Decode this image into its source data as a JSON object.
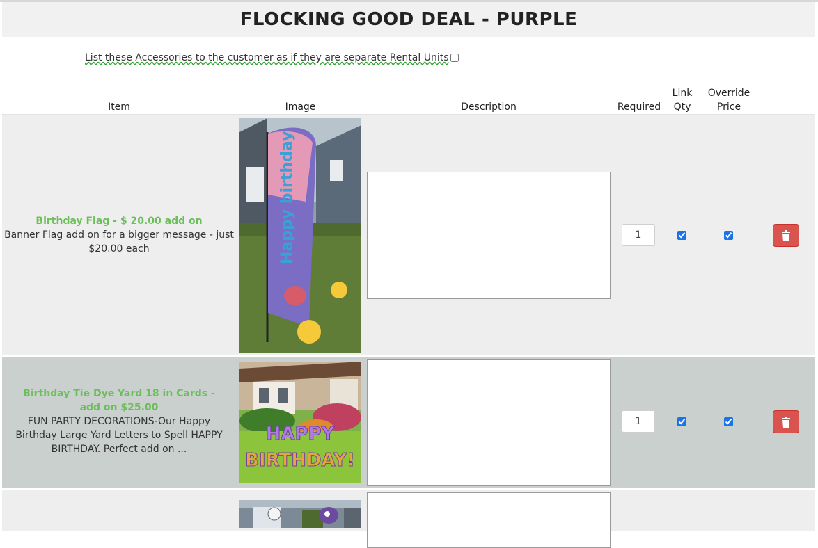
{
  "page_title": "FLOCKING GOOD DEAL - PURPLE",
  "list_option_label": "List these Accessories to the customer as if they are separate Rental Units",
  "list_option_checked": false,
  "table": {
    "headers": {
      "item": "Item",
      "image": "Image",
      "description": "Description",
      "required": "Required",
      "link_qty_line1": "Link",
      "link_qty_line2": "Qty",
      "override_line1": "Override",
      "override_line2": "Price"
    },
    "rows": [
      {
        "name": "Birthday Flag - $ 20.00 add on",
        "summary": "Banner Flag add on for a bigger message - just $20.00 each",
        "image_icon": "birthday-flag-photo",
        "image_text": "Happy birthday",
        "description_value": "",
        "required_qty": "1",
        "link_qty": true,
        "override_price": true,
        "delete_icon": "trash-icon"
      },
      {
        "name": "Birthday Tie Dye Yard 18 in Cards - add on $25.00",
        "summary": "FUN PARTY DECORATIONS-Our Happy Birthday Large Yard Letters to Spell HAPPY BIRTHDAY. Perfect add on ...",
        "image_icon": "yard-letters-photo",
        "image_text_line1": "HAPPY",
        "image_text_line2": "BIRTHDAY!",
        "description_value": "",
        "required_qty": "1",
        "link_qty": true,
        "override_price": true,
        "delete_icon": "trash-icon"
      },
      {
        "image_icon": "flamingo-yard-photo"
      }
    ]
  },
  "colors": {
    "item_name": "#6bbf59",
    "row_odd": "#eeeeee",
    "row_alt": "#c9d0cd",
    "delete_button": "#d9534f"
  }
}
